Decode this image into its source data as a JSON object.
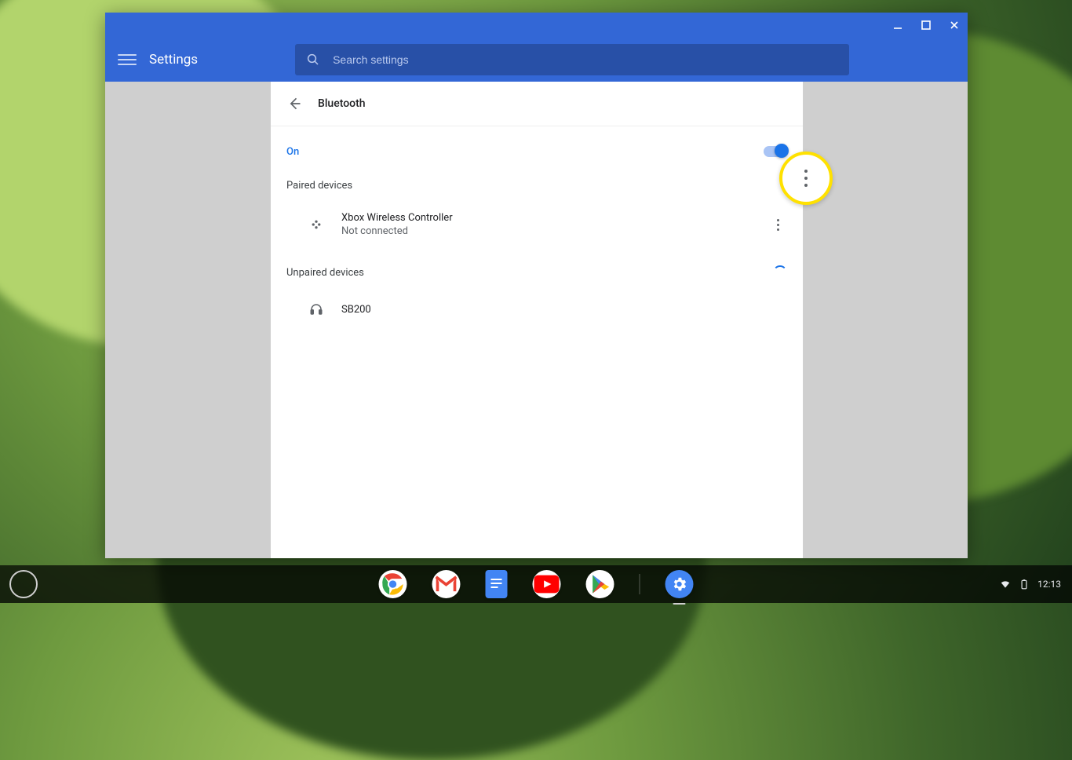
{
  "window": {
    "app_title": "Settings",
    "search_placeholder": "Search settings",
    "page_title": "Bluetooth"
  },
  "bluetooth": {
    "status_label": "On",
    "enabled": true,
    "paired_section": "Paired devices",
    "unpaired_section": "Unpaired devices",
    "paired": [
      {
        "name": "Xbox Wireless Controller",
        "status": "Not connected",
        "icon": "gamepad"
      }
    ],
    "unpaired": [
      {
        "name": "SB200",
        "icon": "headphones"
      }
    ]
  },
  "shelf": {
    "apps": [
      "chrome",
      "gmail",
      "docs",
      "youtube",
      "play",
      "settings"
    ],
    "active_app": "settings",
    "clock": "12:13"
  },
  "colors": {
    "accent": "#1a73e8",
    "header": "#3367d6",
    "highlight": "#ffe100"
  }
}
